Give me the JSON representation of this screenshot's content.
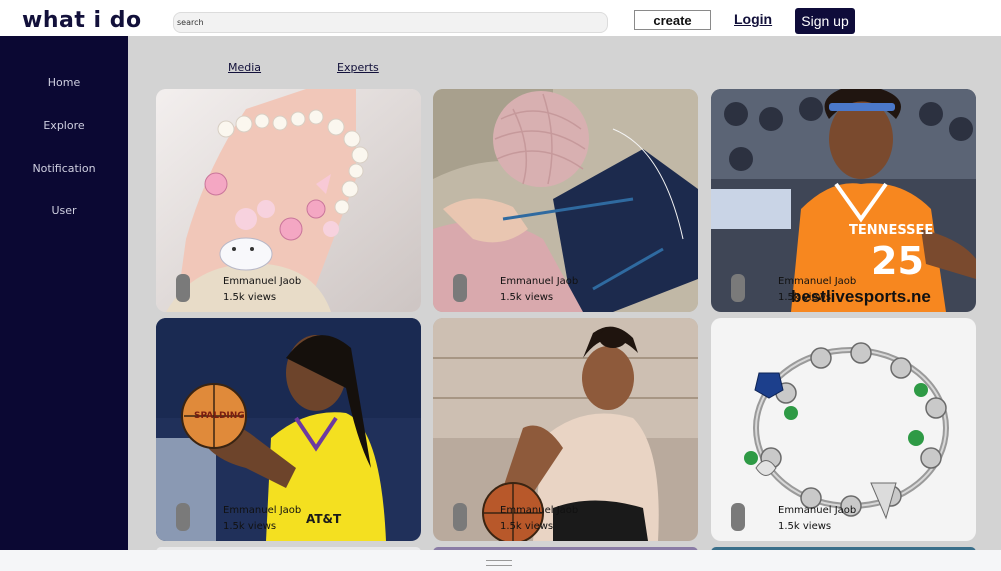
{
  "header": {
    "logo": "what i do",
    "search_placeholder": "search",
    "create_label": "create",
    "login_label": "Login",
    "signup_label": "Sign up"
  },
  "sidebar": {
    "items": [
      {
        "label": "Home"
      },
      {
        "label": "Explore"
      },
      {
        "label": "Notification"
      },
      {
        "label": "User"
      }
    ]
  },
  "tabs": [
    {
      "label": "Media"
    },
    {
      "label": "Experts"
    }
  ],
  "cards": [
    {
      "author": "Emmanuel Jaob",
      "views": "1.5k views",
      "image": "pink-pearl-bracelet"
    },
    {
      "author": "Emmanuel Jaob",
      "views": "1.5k views",
      "image": "knitting-yarn"
    },
    {
      "author": "Emmanuel Jaob",
      "views": "1.5k views",
      "image": "tennessee-basketball-player",
      "watermark": "bestlivesports.ne"
    },
    {
      "author": "Emmanuel Jaob",
      "views": "1.5k views",
      "image": "sparks-basketball-player"
    },
    {
      "author": "Emmanuel Jaob",
      "views": "1.5k views",
      "image": "basketball-dribbling-player"
    },
    {
      "author": "Emmanuel Jaob",
      "views": "1.5k views",
      "image": "silver-charm-bracelet"
    }
  ],
  "colors": {
    "navy": "#0b0833",
    "background": "#d3d3d3",
    "tennessee_orange": "#f7871f",
    "sparks_yellow": "#f4e020"
  }
}
